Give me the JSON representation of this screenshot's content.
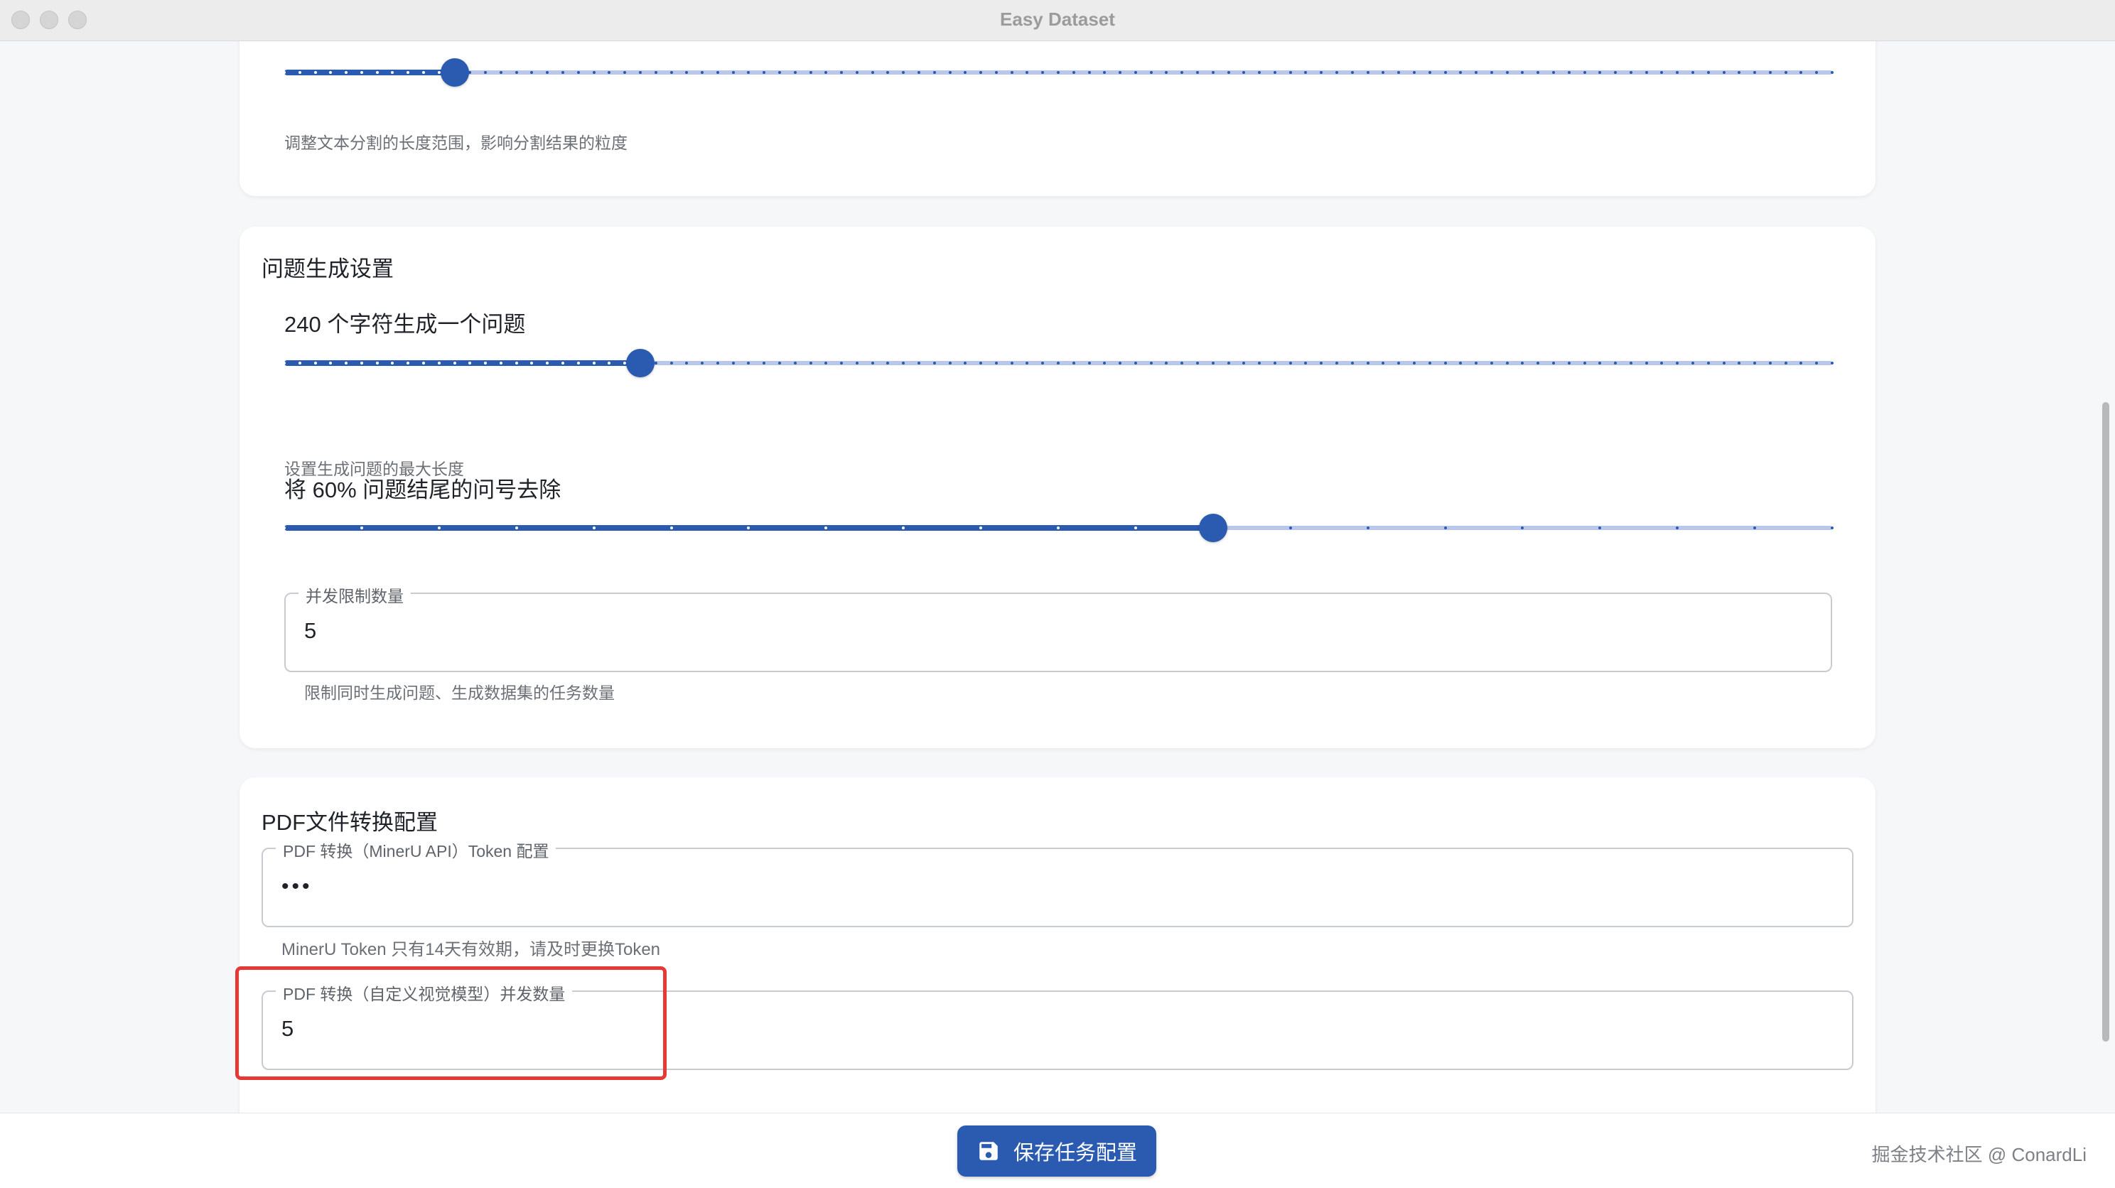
{
  "window": {
    "title": "Easy Dataset"
  },
  "split_card": {
    "slider_value": 0.11,
    "helper": "调整文本分割的长度范围，影响分割结果的粒度"
  },
  "question_card": {
    "title": "问题生成设置",
    "chars_slider": {
      "label": "240 个字符生成一个问题",
      "value": 0.23,
      "helper": "设置生成问题的最大长度"
    },
    "remove_slider": {
      "label": "将 60% 问题结尾的问号去除",
      "value": 0.6
    },
    "concurrency": {
      "legend": "并发限制数量",
      "value": "5",
      "helper": "限制同时生成问题、生成数据集的任务数量"
    }
  },
  "pdf_card": {
    "title": "PDF文件转换配置",
    "token_field": {
      "legend": "PDF 转换（MinerU API）Token 配置",
      "masked": "•••",
      "helper": "MinerU Token 只有14天有效期，请及时更换Token"
    },
    "vision_field": {
      "legend": "PDF 转换（自定义视觉模型）并发数量",
      "value": "5"
    }
  },
  "footer": {
    "save_label": "保存任务配置",
    "watermark": "掘金技术社区 @ ConardLi"
  },
  "colors": {
    "primary": "#2a5bb0",
    "rail": "#b8c7ea",
    "highlight": "#e53935"
  }
}
